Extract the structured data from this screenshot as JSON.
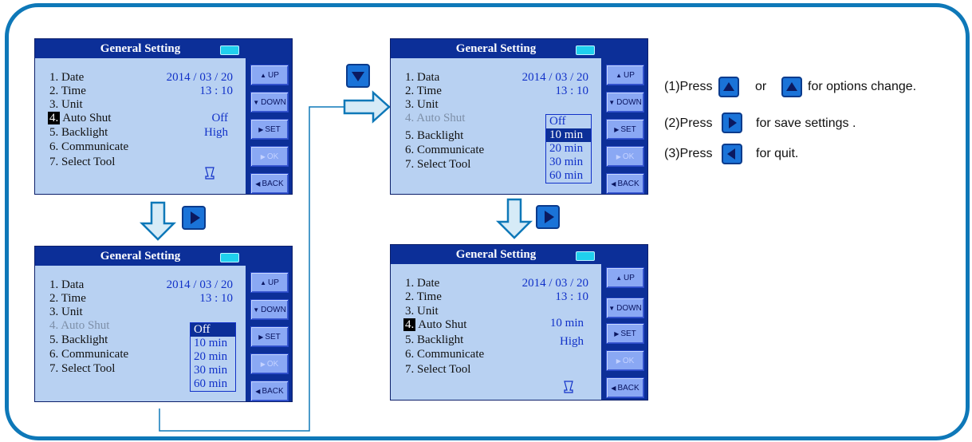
{
  "screens": [
    {
      "title": "General Setting",
      "rows": [
        {
          "num": "1.",
          "label": "Date",
          "value": "2014 / 03 / 20"
        },
        {
          "num": "2.",
          "label": "Time",
          "value": "13 : 10"
        },
        {
          "num": "3.",
          "label": "Unit",
          "value": ""
        },
        {
          "num": "4.",
          "label": "Auto Shut",
          "value": "Off"
        },
        {
          "num": "5.",
          "label": "Backlight",
          "value": "High"
        },
        {
          "num": "6.",
          "label": "Communicate",
          "value": ""
        },
        {
          "num": "7.",
          "label": "Select Tool",
          "value": ""
        }
      ]
    },
    {
      "title": "General Setting",
      "rows": [
        {
          "num": "1.",
          "label": "Data",
          "value": "2014 / 03 / 20"
        },
        {
          "num": "2.",
          "label": "Time",
          "value": "13 : 10"
        },
        {
          "num": "3.",
          "label": "Unit",
          "value": ""
        },
        {
          "num": "4.",
          "label": "Auto Shut",
          "value": ""
        },
        {
          "num": "5.",
          "label": "Backlight",
          "value": ""
        },
        {
          "num": "6.",
          "label": "Communicate",
          "value": ""
        },
        {
          "num": "7.",
          "label": "Select Tool",
          "value": ""
        }
      ],
      "dropdown": [
        "Off",
        "10  min",
        "20  min",
        "30  min",
        "60  min"
      ]
    },
    {
      "title": "General Setting",
      "rows": [
        {
          "num": "1.",
          "label": "Data",
          "value": "2014 / 03 / 20"
        },
        {
          "num": "2.",
          "label": "Time",
          "value": "13 : 10"
        },
        {
          "num": "3.",
          "label": "Unit",
          "value": ""
        },
        {
          "num": "4.",
          "label": "Auto Shut",
          "value": ""
        },
        {
          "num": "5.",
          "label": "Backlight",
          "value": ""
        },
        {
          "num": "6.",
          "label": "Communicate",
          "value": ""
        },
        {
          "num": "7.",
          "label": "Select Tool",
          "value": ""
        }
      ],
      "dropdown": [
        "Off",
        "10  min",
        "20  min",
        "30  min",
        "60  min"
      ]
    },
    {
      "title": "General Setting",
      "rows": [
        {
          "num": "1.",
          "label": "Date",
          "value": "2014 / 03 / 20"
        },
        {
          "num": "2.",
          "label": "Time",
          "value": "13 : 10"
        },
        {
          "num": "3.",
          "label": "Unit",
          "value": ""
        },
        {
          "num": "4.",
          "label": "Auto Shut",
          "value": "10 min"
        },
        {
          "num": "5.",
          "label": "Backlight",
          "value": "High"
        },
        {
          "num": "6.",
          "label": "Communicate",
          "value": ""
        },
        {
          "num": "7.",
          "label": "Select Tool",
          "value": ""
        }
      ]
    }
  ],
  "buttons": {
    "up": "UP",
    "down": "DOWN",
    "set": "SET",
    "ok": "OK",
    "back": "BACK"
  },
  "notes": {
    "n1_prefix": "(1)Press",
    "n1_or": "or",
    "n1_suffix": "for options change.",
    "n2_prefix": "(2)Press",
    "n2_suffix": "for save settings .",
    "n3_prefix": "(3)Press",
    "n3_suffix": "for quit."
  },
  "icons": [
    "up-triangle-icon",
    "down-triangle-icon",
    "right-triangle-icon",
    "left-triangle-icon",
    "battery-icon",
    "select-tool-icon"
  ],
  "colors": {
    "frame": "#0e78b8",
    "header": "#0c2f98",
    "screen_bg": "#b8d1f2",
    "value_text": "#1131c8",
    "icon_blue": "#1a73d8"
  }
}
